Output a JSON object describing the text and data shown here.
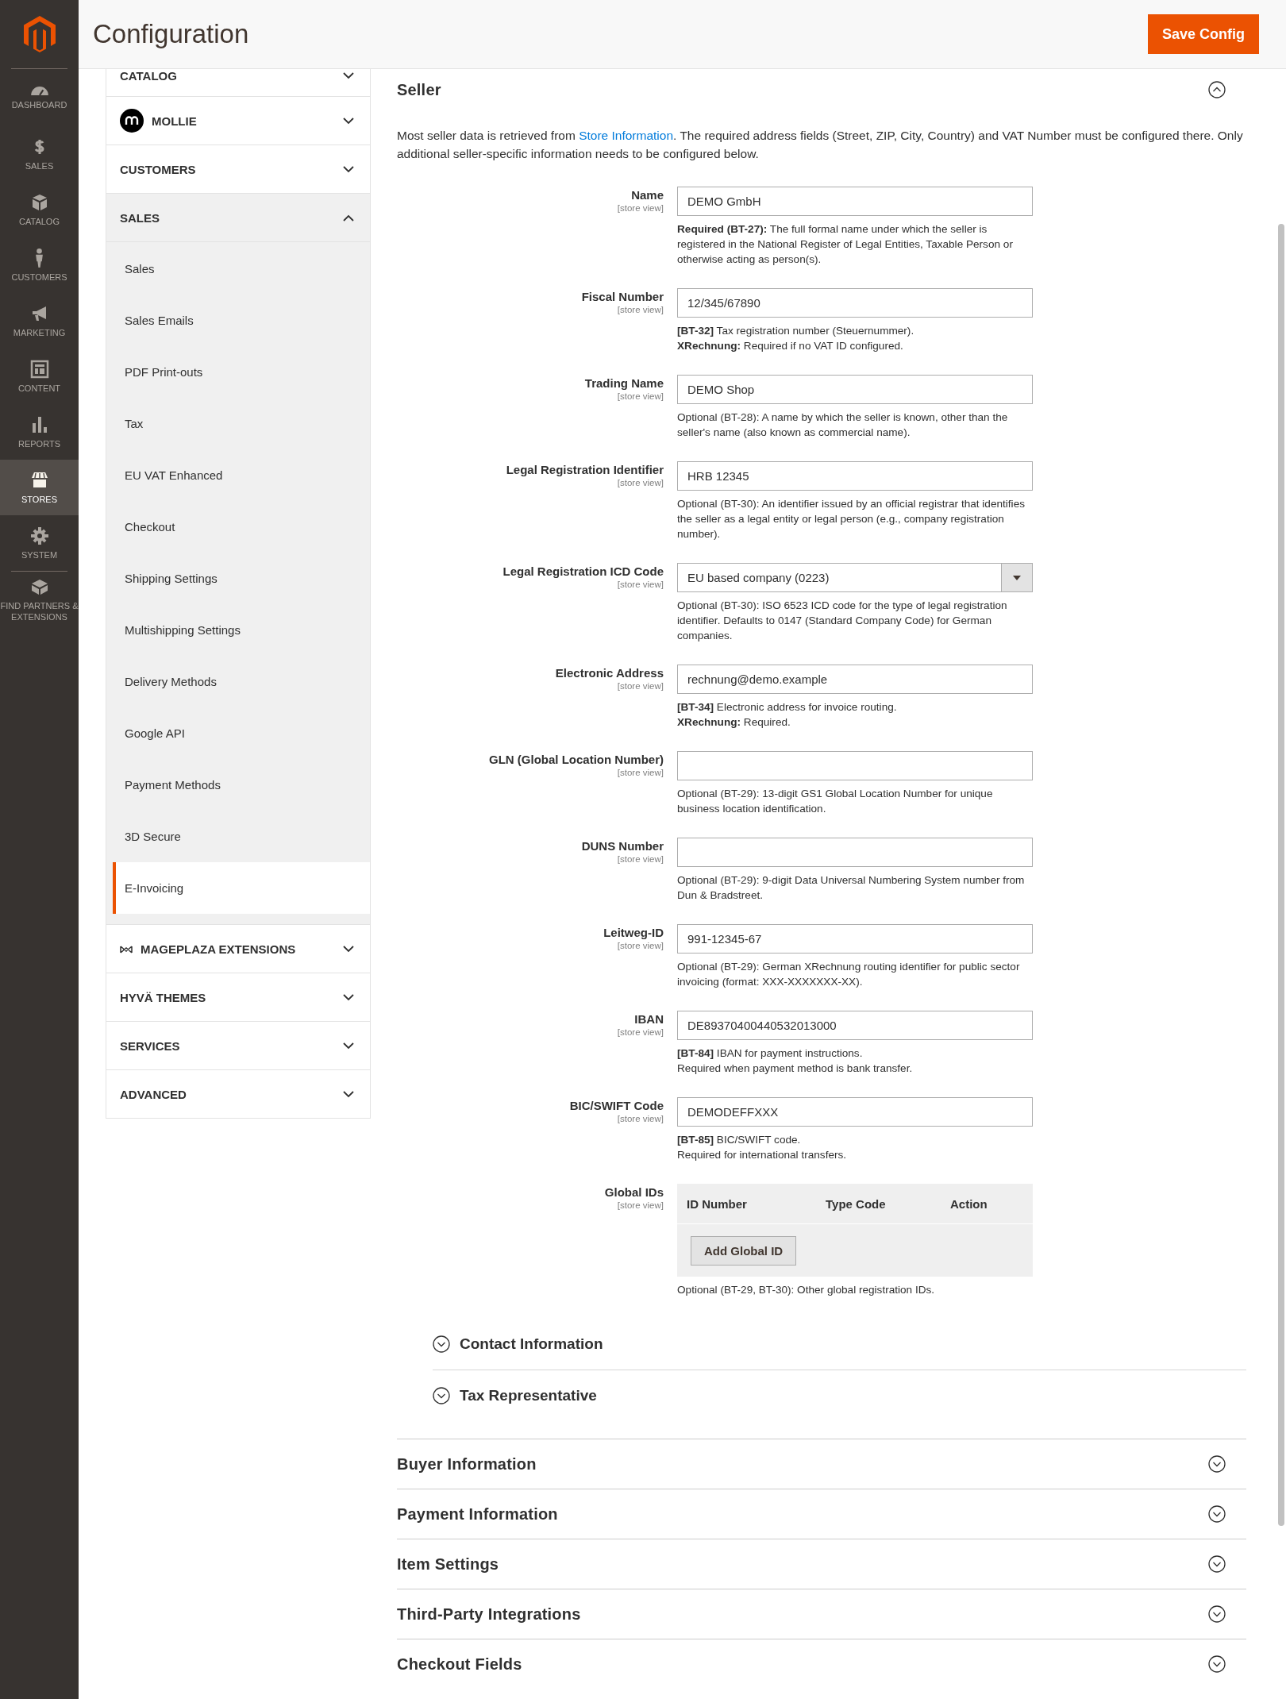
{
  "nav": {
    "items": [
      {
        "label": "DASHBOARD",
        "selected": false
      },
      {
        "label": "SALES",
        "selected": false
      },
      {
        "label": "CATALOG",
        "selected": false
      },
      {
        "label": "CUSTOMERS",
        "selected": false
      },
      {
        "label": "MARKETING",
        "selected": false
      },
      {
        "label": "CONTENT",
        "selected": false
      },
      {
        "label": "REPORTS",
        "selected": false
      },
      {
        "label": "STORES",
        "selected": true
      },
      {
        "label": "SYSTEM",
        "selected": false
      },
      {
        "label": "FIND PARTNERS & EXTENSIONS",
        "selected": false
      }
    ]
  },
  "header": {
    "title": "Configuration",
    "save_button": "Save Config"
  },
  "config_tabs": [
    {
      "label": "CATALOG",
      "kind": "plain",
      "expanded": false
    },
    {
      "label": "MOLLIE",
      "kind": "mollie",
      "expanded": false
    },
    {
      "label": "CUSTOMERS",
      "kind": "plain",
      "expanded": false
    },
    {
      "label": "SALES",
      "kind": "plain",
      "expanded": true,
      "children": [
        {
          "label": "Sales",
          "selected": false
        },
        {
          "label": "Sales Emails",
          "selected": false
        },
        {
          "label": "PDF Print-outs",
          "selected": false
        },
        {
          "label": "Tax",
          "selected": false
        },
        {
          "label": "EU VAT Enhanced",
          "selected": false
        },
        {
          "label": "Checkout",
          "selected": false
        },
        {
          "label": "Shipping Settings",
          "selected": false
        },
        {
          "label": "Multishipping Settings",
          "selected": false
        },
        {
          "label": "Delivery Methods",
          "selected": false
        },
        {
          "label": "Google API",
          "selected": false
        },
        {
          "label": "Payment Methods",
          "selected": false
        },
        {
          "label": "3D Secure",
          "selected": false
        },
        {
          "label": "E-Invoicing",
          "selected": true
        }
      ]
    },
    {
      "label": "MAGEPLAZA EXTENSIONS",
      "kind": "mageplaza",
      "expanded": false
    },
    {
      "label": "HYVÄ THEMES",
      "kind": "plain",
      "expanded": false
    },
    {
      "label": "SERVICES",
      "kind": "plain",
      "expanded": false
    },
    {
      "label": "ADVANCED",
      "kind": "plain",
      "expanded": false
    }
  ],
  "seller": {
    "title": "Seller",
    "expanded": true,
    "description": {
      "before": "Most seller data is retrieved from ",
      "link": "Store Information",
      "after": ". The required address fields (Street, ZIP, City, Country) and VAT Number must be configured there. Only additional seller-specific information needs to be configured below."
    },
    "fields": [
      {
        "kind": "text",
        "label": "Name",
        "scope": "[store view]",
        "value": "DEMO GmbH",
        "note": [
          "**Required (BT-27):** The full formal name under which the seller is registered in the National Register of Legal Entities, Taxable Person or otherwise acting as person(s)."
        ]
      },
      {
        "kind": "text",
        "label": "Fiscal Number",
        "scope": "[store view]",
        "value": "12/345/67890",
        "note": [
          "**[BT-32]** Tax registration number (Steuernummer).",
          "**XRechnung:** Required if no VAT ID configured."
        ]
      },
      {
        "kind": "text",
        "label": "Trading Name",
        "scope": "[store view]",
        "value": "DEMO Shop",
        "note": [
          "Optional (BT-28): A name by which the seller is known, other than the seller's name (also known as commercial name)."
        ]
      },
      {
        "kind": "text",
        "label": "Legal Registration Identifier",
        "scope": "[store view]",
        "value": "HRB 12345",
        "note": [
          "Optional (BT-30): An identifier issued by an official registrar that identifies the seller as a legal entity or legal person (e.g., company registration number)."
        ]
      },
      {
        "kind": "select",
        "label": "Legal Registration ICD Code",
        "scope": "[store view]",
        "value": "EU based company (0223)",
        "note": [
          "Optional (BT-30): ISO 6523 ICD code for the type of legal registration identifier. Defaults to 0147 (Standard Company Code) for German companies."
        ]
      },
      {
        "kind": "text",
        "label": "Electronic Address",
        "scope": "[store view]",
        "value": "rechnung@demo.example",
        "note": [
          "**[BT-34]** Electronic address for invoice routing.",
          "**XRechnung:** Required."
        ]
      },
      {
        "kind": "text",
        "label": "GLN (Global Location Number)",
        "scope": "[store view]",
        "note": [
          "Optional (BT-29): 13-digit GS1 Global Location Number for unique business location identification."
        ]
      },
      {
        "kind": "text",
        "label": "DUNS Number",
        "scope": "[store view]",
        "note": [
          "Optional (BT-29): 9-digit Data Universal Numbering System number from Dun & Bradstreet."
        ]
      },
      {
        "kind": "text",
        "label": "Leitweg-ID",
        "scope": "[store view]",
        "value": "991-12345-67",
        "note": [
          "Optional (BT-29): German XRechnung routing identifier for public sector invoicing (format: XXX-XXXXXXX-XX)."
        ]
      },
      {
        "kind": "text",
        "label": "IBAN",
        "scope": "[store view]",
        "value": "DE89370400440532013000",
        "note": [
          "**[BT-84]** IBAN for payment instructions.",
          "Required when payment method is bank transfer."
        ]
      },
      {
        "kind": "text",
        "label": "BIC/SWIFT Code",
        "scope": "[store view]",
        "value": "DEMODEFFXXX",
        "note": [
          "**[BT-85]** BIC/SWIFT code.",
          "Required for international transfers."
        ]
      },
      {
        "kind": "table",
        "label": "Global IDs",
        "scope": "[store view]",
        "columns": [
          "ID Number",
          "Type Code",
          "Action"
        ],
        "button": "Add Global ID",
        "note": [
          "Optional (BT-29, BT-30): Other global registration IDs."
        ]
      }
    ],
    "subsections": [
      {
        "title": "Contact Information",
        "expanded": false
      },
      {
        "title": "Tax Representative",
        "expanded": false
      }
    ]
  },
  "sections": [
    {
      "title": "Buyer Information",
      "expanded": false
    },
    {
      "title": "Payment Information",
      "expanded": false
    },
    {
      "title": "Item Settings",
      "expanded": false
    },
    {
      "title": "Third-Party Integrations",
      "expanded": false
    },
    {
      "title": "Checkout Fields",
      "expanded": false
    }
  ]
}
